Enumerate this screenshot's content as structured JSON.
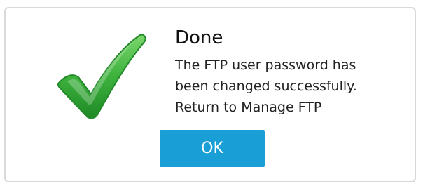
{
  "dialog": {
    "title": "Done",
    "message_line1": "The FTP user password has",
    "message_line2": "been changed successfully.",
    "message_line3_prefix": "Return to ",
    "link_label": "Manage FTP",
    "ok_label": "OK",
    "icon": "checkmark-icon"
  },
  "colors": {
    "accent": "#1a9ed6",
    "check_green": "#3db23d",
    "border": "#d9d9d9"
  }
}
